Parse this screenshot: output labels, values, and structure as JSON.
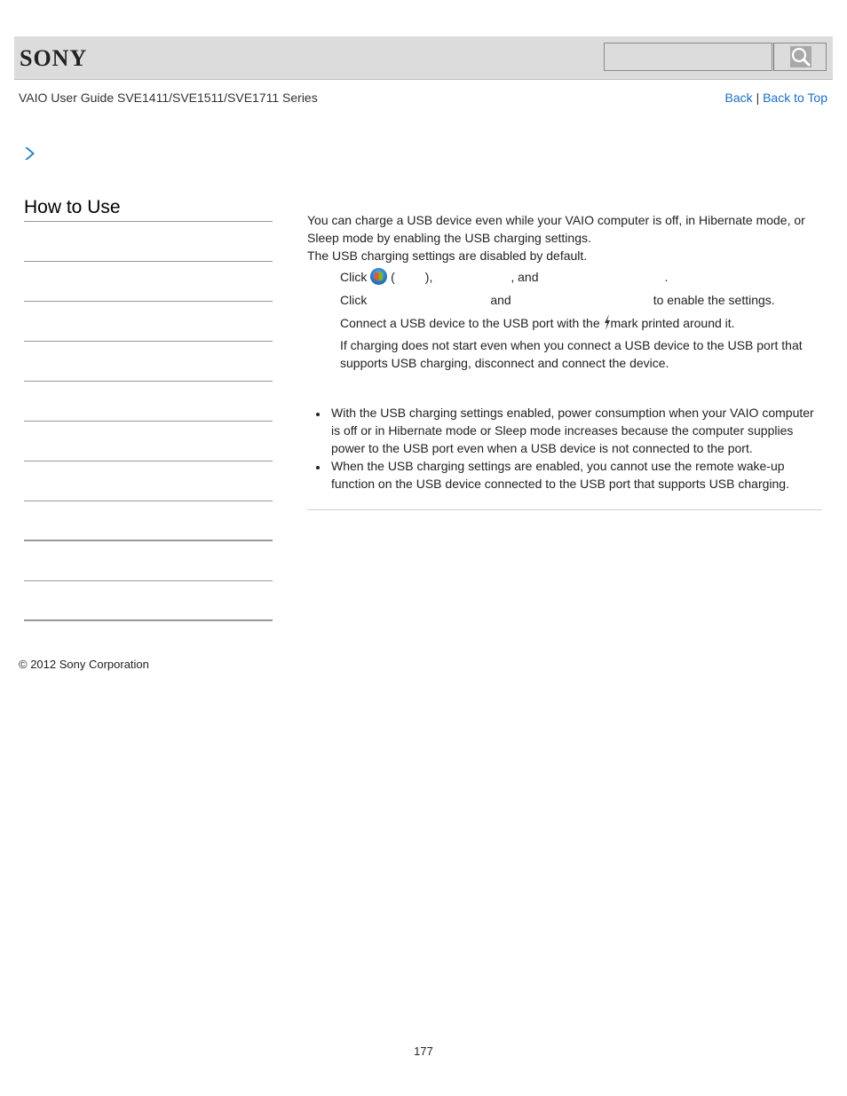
{
  "header": {
    "logo": "SONY",
    "search": {
      "placeholder": "",
      "value": ""
    },
    "search_icon": "magnifier-icon"
  },
  "guide_title": "VAIO User Guide SVE1411/SVE1511/SVE1711 Series",
  "nav": {
    "back": "Back",
    "separator": "|",
    "back_to_top": "Back to Top"
  },
  "breadcrumb_icon": "chevron-right-icon",
  "sidebar": {
    "heading": "How to Use",
    "items": [
      "",
      "",
      "",
      "",
      "",
      "",
      "",
      "",
      "",
      ""
    ]
  },
  "content": {
    "intro": [
      "You can charge a USB device even while your VAIO computer is off, in Hibernate mode, or Sleep mode by enabling the USB charging settings.",
      "The USB charging settings are disabled by default."
    ],
    "step1": {
      "click": "Click",
      "open_paren": "(",
      "close_paren": "),",
      "and": ", and",
      "period": "."
    },
    "step2": {
      "click": "Click",
      "and": "and",
      "tail": "to enable the settings."
    },
    "step3": {
      "before": "Connect a USB device to the USB port with the",
      "after": "mark printed around it.",
      "hint": "If charging does not start even when you connect a USB device to the USB port that supports USB charging, disconnect and connect the device."
    },
    "notes": [
      "With the USB charging settings enabled, power consumption when your VAIO computer is off or in Hibernate mode or Sleep mode increases because the computer supplies power to the USB port even when a USB device is not connected to the port.",
      "When the USB charging settings are enabled, you cannot use the remote wake-up function on the USB device connected to the USB port that supports USB charging."
    ]
  },
  "footer": {
    "copyright": "© 2012 Sony Corporation",
    "page_number": "177"
  },
  "colors": {
    "link": "#1a6fc4",
    "header_bg": "#dcdcdc",
    "chevron": "#2a86c8"
  }
}
